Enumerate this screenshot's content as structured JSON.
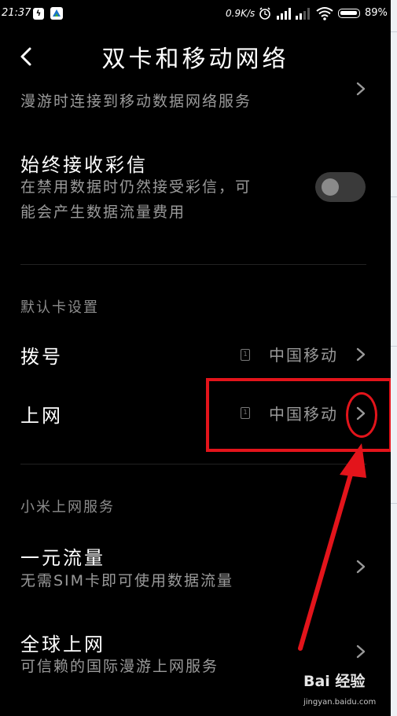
{
  "status_bar": {
    "time": "21:37",
    "speed": "0.9K/s",
    "battery": "89%"
  },
  "header": {
    "title": "双卡和移动网络"
  },
  "roaming": {
    "subtitle": "漫游时连接到移动数据网络服务"
  },
  "mms": {
    "title": "始终接收彩信",
    "subtitle_line1": "在禁用数据时仍然接受彩信，可",
    "subtitle_line2": "能会产生数据流量费用",
    "toggle_on": false
  },
  "default_card": {
    "section_title": "默认卡设置",
    "dial": {
      "label": "拨号",
      "value": "中国移动",
      "sim": "1"
    },
    "internet": {
      "label": "上网",
      "value": "中国移动",
      "sim": "1"
    }
  },
  "xiaomi_services": {
    "section_title": "小米上网服务",
    "one_yuan": {
      "title": "一元流量",
      "subtitle": "无需SIM卡即可使用数据流量"
    },
    "global": {
      "title": "全球上网",
      "subtitle": "可信赖的国际漫游上网服务"
    }
  },
  "watermark": {
    "logo": "Bai 经验",
    "url": "jingyan.baidu.com"
  },
  "colors": {
    "annotation": "#e3141b",
    "background": "#000000"
  }
}
